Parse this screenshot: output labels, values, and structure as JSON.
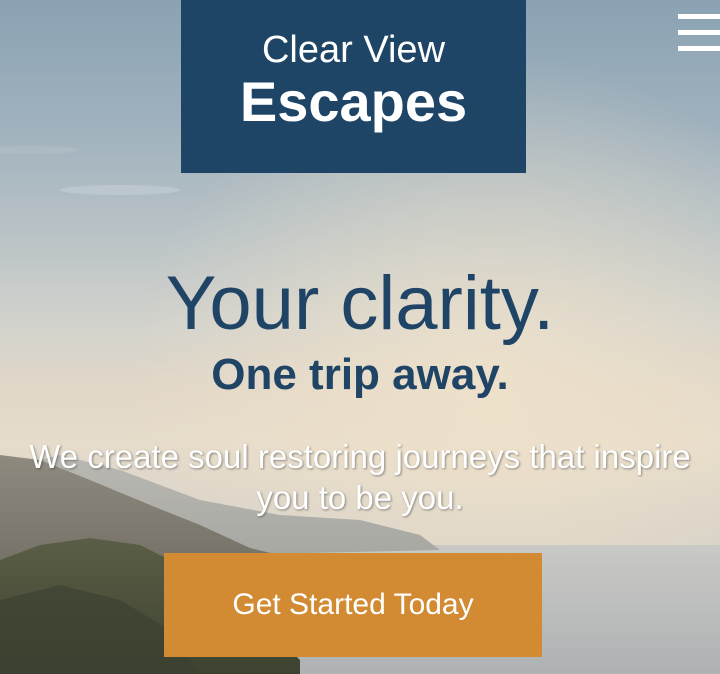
{
  "brand": {
    "line1": "Clear View",
    "line2": "Escapes",
    "background_color": "#1e4466"
  },
  "nav": {
    "menu_icon": "hamburger-menu-icon"
  },
  "hero": {
    "headline": "Your clarity.",
    "subheadline": "One trip away.",
    "tagline": "We create soul restoring journeys that inspire you to be you.",
    "text_color": "#1f4466",
    "background_image": "coastal cliffs overlooking sea at sunset"
  },
  "cta": {
    "label": "Get Started Today",
    "color": "#d28b33"
  }
}
